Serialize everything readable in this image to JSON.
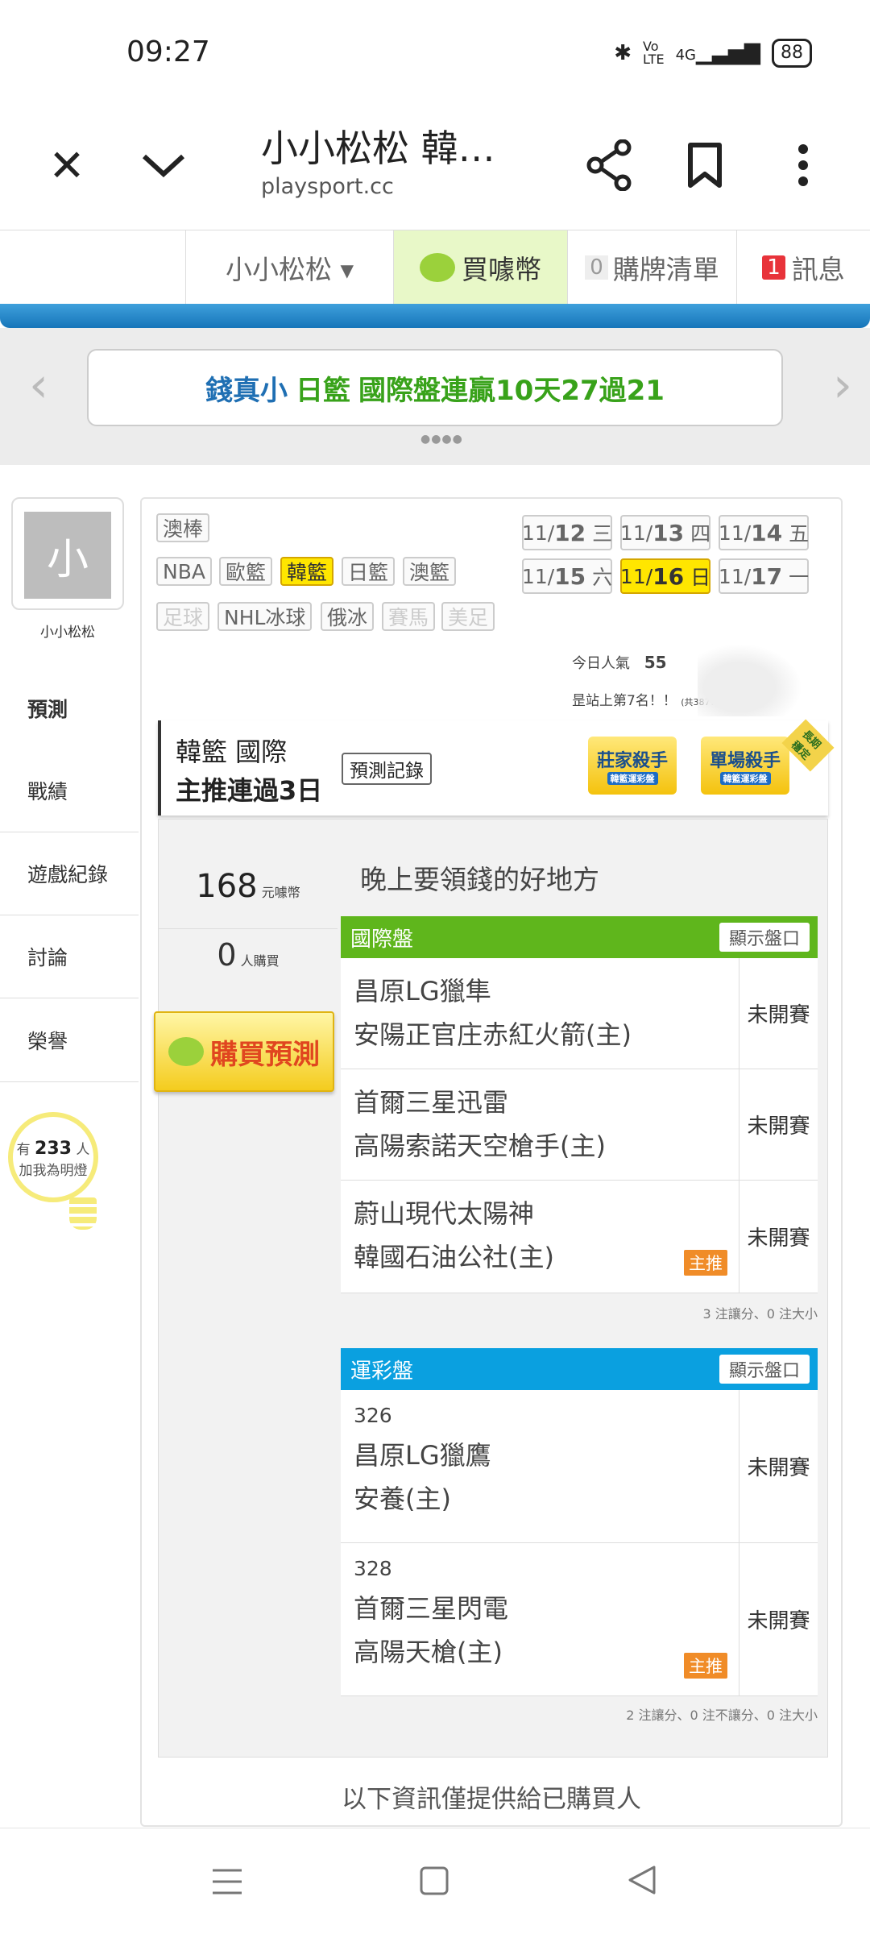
{
  "status_bar": {
    "time": "09:27",
    "signal": "4G",
    "battery": "88"
  },
  "browser": {
    "title": "小小松松 韓…",
    "url": "playsport.cc"
  },
  "site_header": {
    "user_menu": "小小松松 ▾",
    "buy_coin": "買噱幣",
    "cart_count": "0",
    "cart": "購牌清單",
    "msg_count": "1",
    "msg": "訊息"
  },
  "banner": {
    "text_a": "錢真小",
    "text_b": "日籃",
    "text_c": "國際盤連贏10天27過21",
    "dots": "●●●●"
  },
  "profile": {
    "avatar_char": "小",
    "name": "小小松松"
  },
  "side_nav": {
    "items": [
      "預測",
      "戰績",
      "遊戲紀錄",
      "討論",
      "榮譽"
    ]
  },
  "fans": {
    "prefix": "有",
    "count": "233",
    "unit": "人",
    "caption": "加我為明燈"
  },
  "league_tags": [
    "澳棒",
    "NBA",
    "歐籃",
    "韓籃",
    "日籃",
    "澳籃",
    "足球",
    "NHL冰球",
    "俄冰",
    "賽馬",
    "美足"
  ],
  "dates": [
    {
      "md": "11/",
      "d": "12",
      "w": "三"
    },
    {
      "md": "11/",
      "d": "13",
      "w": "四"
    },
    {
      "md": "11/",
      "d": "14",
      "w": "五"
    },
    {
      "md": "11/",
      "d": "15",
      "w": "六"
    },
    {
      "md": "11/",
      "d": "16",
      "w": "日"
    },
    {
      "md": "11/",
      "d": "17",
      "w": "一"
    }
  ],
  "popularity": {
    "label": "今日人氣",
    "value": "55",
    "rank": "昰站上第7名！！",
    "total": "(共38771人)"
  },
  "league_box": {
    "line1": "韓籃 國際",
    "line2": "主推連過3日",
    "record_btn": "預測記錄",
    "badge1": "莊家殺手",
    "badge1_sub": "韓籃運彩盤",
    "badge2": "單場殺手",
    "badge2_sub": "韓籃運彩盤",
    "ribbon": "長期穩定"
  },
  "prediction": {
    "price": "168",
    "price_unit": "元噱幣",
    "buyers": "0",
    "buyers_unit": "人購買",
    "buy_btn": "購買預測",
    "headline": "晚上要領錢的好地方",
    "intl": {
      "title": "國際盤",
      "show_btn": "顯示盤口",
      "games": [
        {
          "away": "昌原LG獵隼",
          "home": "安陽正官庄赤紅火箭(主)",
          "status": "未開賽"
        },
        {
          "away": "首爾三星迅雷",
          "home": "高陽索諾天空槍手(主)",
          "status": "未開賽"
        },
        {
          "away": "蔚山現代太陽神",
          "home": "韓國石油公社(主)",
          "status": "未開賽",
          "tag": "主推"
        }
      ],
      "note": "3 注讓分、0 注大小"
    },
    "lottery": {
      "title": "運彩盤",
      "show_btn": "顯示盤口",
      "games": [
        {
          "num": "326",
          "away": "昌原LG獵鷹",
          "home": "安養(主)",
          "status": "未開賽"
        },
        {
          "num": "328",
          "away": "首爾三星閃電",
          "home": "高陽天槍(主)",
          "status": "未開賽",
          "tag": "主推"
        }
      ],
      "note": "2 注讓分、0 注不讓分、0 注大小"
    },
    "footer": "以下資訊僅提供給已購買人"
  },
  "colors": {
    "intl_green": "#5fb61c",
    "lottery_blue": "#0aa0e0",
    "selected_yellow": "#ffe600",
    "accent_orange": "#f08c28"
  },
  "icons": [
    "close-icon",
    "chevron-down-icon",
    "share-icon",
    "bookmark-icon",
    "more-icon",
    "bluetooth-icon",
    "menu-icon",
    "home-icon",
    "back-icon"
  ]
}
